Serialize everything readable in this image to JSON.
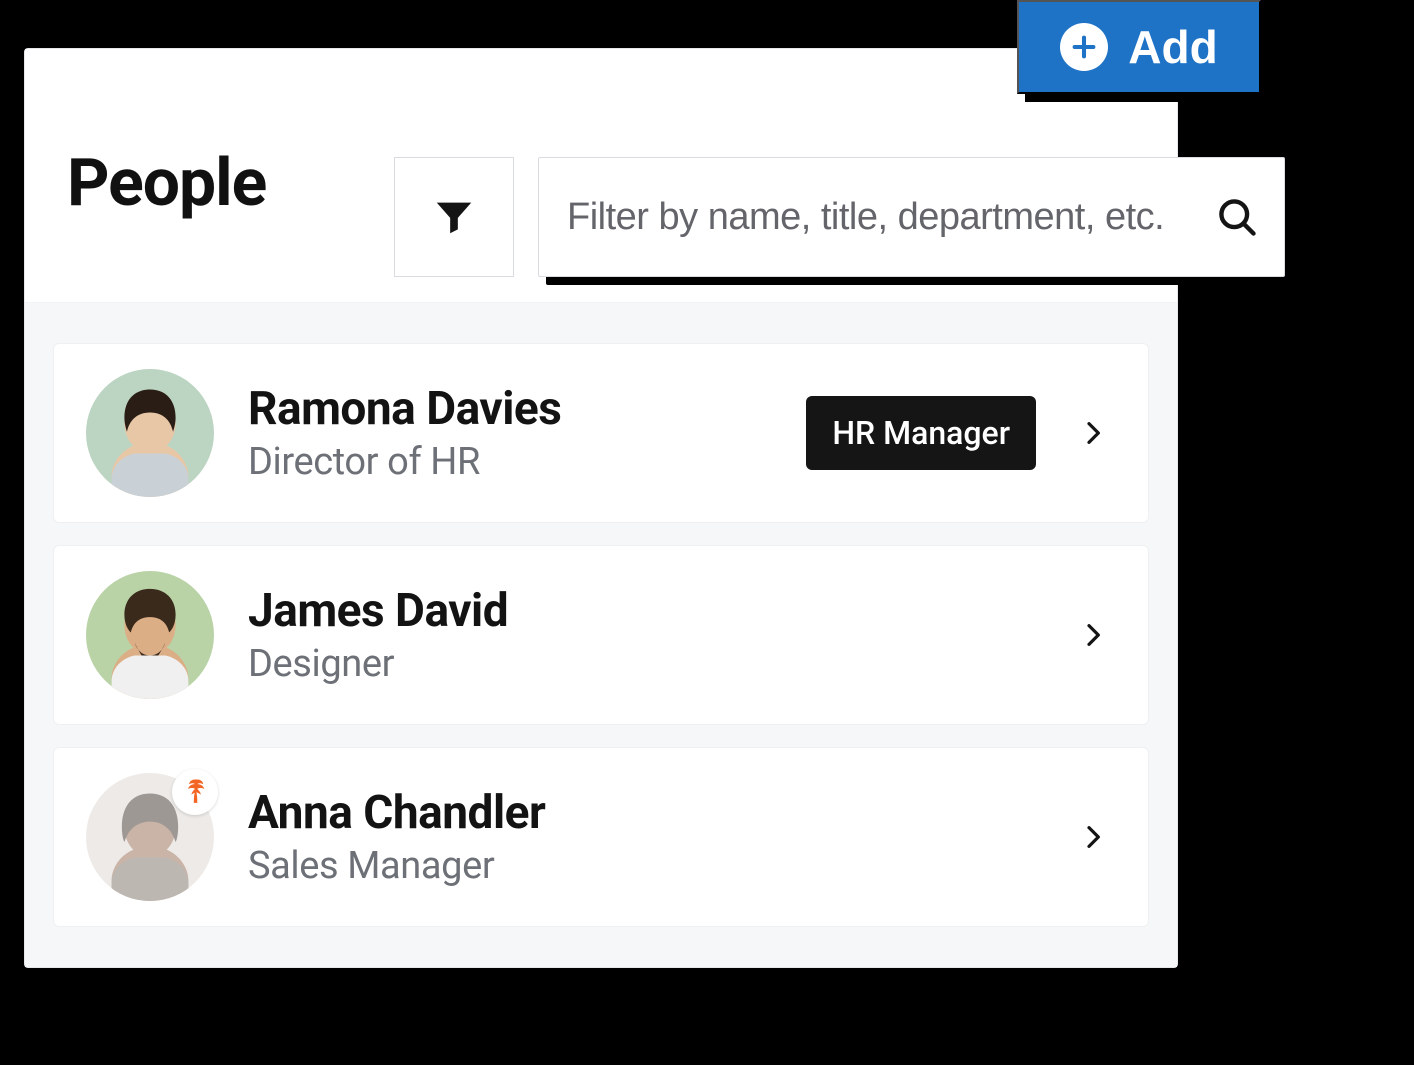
{
  "header": {
    "title": "People",
    "add_label": "Add"
  },
  "search": {
    "placeholder": "Filter by name, title, department, etc."
  },
  "icons": {
    "filter": "filter-icon",
    "search": "search-icon",
    "plus": "plus-icon",
    "chevron_right": "chevron-right-icon",
    "palm_tree": "palm-tree-icon"
  },
  "colors": {
    "accent": "#1e73c7",
    "badge_bg": "#151515",
    "status_icon": "#f26522"
  },
  "people": [
    {
      "name": "Ramona Davies",
      "title": "Director of HR",
      "badge": "HR Manager",
      "status_icon": null,
      "muted": false,
      "avatar_colors": {
        "bg": "#bcd4c2",
        "skin": "#e8c7a6",
        "hair": "#2a1d16",
        "shirt": "#c9d0d6"
      }
    },
    {
      "name": "James David",
      "title": "Designer",
      "badge": null,
      "status_icon": null,
      "muted": false,
      "avatar_colors": {
        "bg": "#b9d3a7",
        "skin": "#dcae86",
        "hair": "#3a2a1c",
        "shirt": "#f0f0f0"
      }
    },
    {
      "name": "Anna Chandler",
      "title": "Sales Manager",
      "badge": null,
      "status_icon": "palm-tree-icon",
      "muted": true,
      "avatar_colors": {
        "bg": "#d9d2cd",
        "skin": "#8a5a3e",
        "hair": "#2b1d15",
        "shirt": "#6e6155"
      }
    }
  ]
}
